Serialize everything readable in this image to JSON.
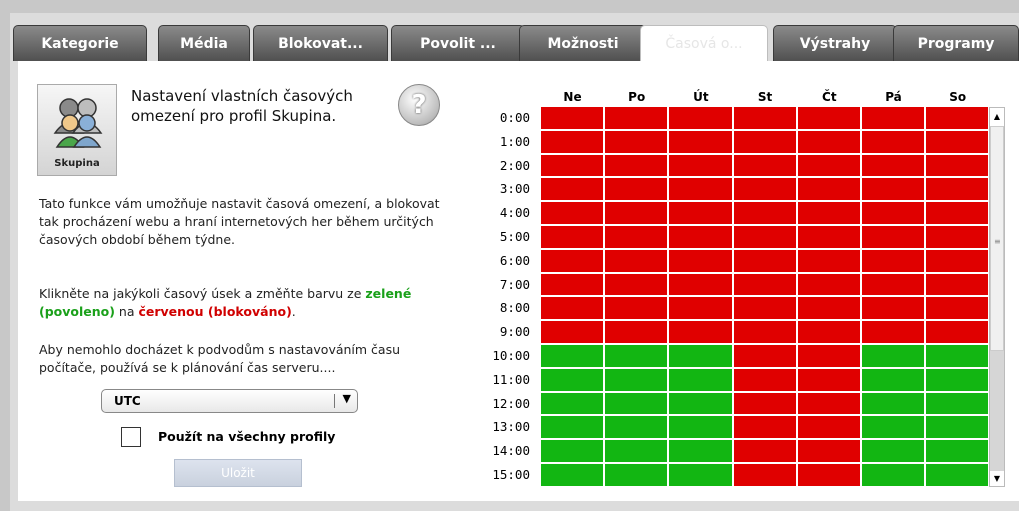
{
  "tabs": [
    {
      "label": "Kategorie",
      "active": false
    },
    {
      "label": "Média",
      "active": false
    },
    {
      "label": "Blokovat...",
      "active": false
    },
    {
      "label": "Povolit ...",
      "active": false
    },
    {
      "label": "Možnosti",
      "active": false
    },
    {
      "label": "Časová o...",
      "active": true
    },
    {
      "label": "Výstrahy",
      "active": false
    },
    {
      "label": "Programy",
      "active": false
    }
  ],
  "profile": {
    "avatar_label": "Skupina",
    "title": "Nastavení vlastních časových omezení pro profil Skupina.",
    "help_icon": "help-icon"
  },
  "description": {
    "p1": "Tato funkce vám umožňuje nastavit časová omezení, a blokovat tak procházení webu a hraní internetových her během určitých časových období během týdne.",
    "p2_before": "Klikněte na jakýkoli časový úsek a změňte barvu ze ",
    "p2_green": "zelené (povoleno)",
    "p2_middle": " na ",
    "p2_red": "červenou (blokováno)",
    "p2_end": ".",
    "p3": "Aby nemohlo docházet k podvodům s nastavováním času počítače, používá se k plánování čas serveru...."
  },
  "timezone": {
    "selected": "UTC"
  },
  "apply_all_label": "Použít na všechny profily",
  "save_label": "Uložit",
  "colors": {
    "allowed": "#12b612",
    "blocked": "#e00000"
  },
  "schedule": {
    "days": [
      "Ne",
      "Po",
      "Út",
      "St",
      "Čt",
      "Pá",
      "So"
    ],
    "hours": [
      "0:00",
      "1:00",
      "2:00",
      "3:00",
      "4:00",
      "5:00",
      "6:00",
      "7:00",
      "8:00",
      "9:00",
      "10:00",
      "11:00",
      "12:00",
      "13:00",
      "14:00",
      "15:00"
    ],
    "blocked": [
      [
        1,
        1,
        1,
        1,
        1,
        1,
        1
      ],
      [
        1,
        1,
        1,
        1,
        1,
        1,
        1
      ],
      [
        1,
        1,
        1,
        1,
        1,
        1,
        1
      ],
      [
        1,
        1,
        1,
        1,
        1,
        1,
        1
      ],
      [
        1,
        1,
        1,
        1,
        1,
        1,
        1
      ],
      [
        1,
        1,
        1,
        1,
        1,
        1,
        1
      ],
      [
        1,
        1,
        1,
        1,
        1,
        1,
        1
      ],
      [
        1,
        1,
        1,
        1,
        1,
        1,
        1
      ],
      [
        1,
        1,
        1,
        1,
        1,
        1,
        1
      ],
      [
        1,
        1,
        1,
        1,
        1,
        1,
        1
      ],
      [
        0,
        0,
        0,
        1,
        1,
        0,
        0
      ],
      [
        0,
        0,
        0,
        1,
        1,
        0,
        0
      ],
      [
        0,
        0,
        0,
        1,
        1,
        0,
        0
      ],
      [
        0,
        0,
        0,
        1,
        1,
        0,
        0
      ],
      [
        0,
        0,
        0,
        1,
        1,
        0,
        0
      ],
      [
        0,
        0,
        0,
        1,
        1,
        0,
        0
      ]
    ]
  }
}
